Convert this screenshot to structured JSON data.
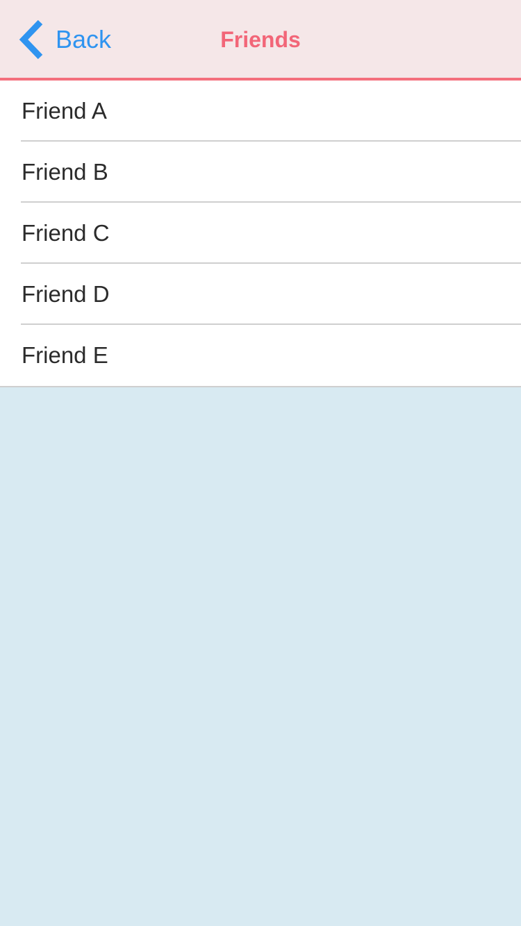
{
  "colors": {
    "navbar_background": "#f5e7e8",
    "navbar_accent_border": "#f46f7d",
    "title_color": "#f26678",
    "back_color": "#2f94f0",
    "list_background": "#ffffff",
    "page_background": "#d8eaf2"
  },
  "navbar": {
    "back_label": "Back",
    "back_icon": "chevron-left-icon",
    "title": "Friends"
  },
  "friends": [
    {
      "label": "Friend A"
    },
    {
      "label": "Friend B"
    },
    {
      "label": "Friend C"
    },
    {
      "label": "Friend D"
    },
    {
      "label": "Friend E"
    }
  ]
}
